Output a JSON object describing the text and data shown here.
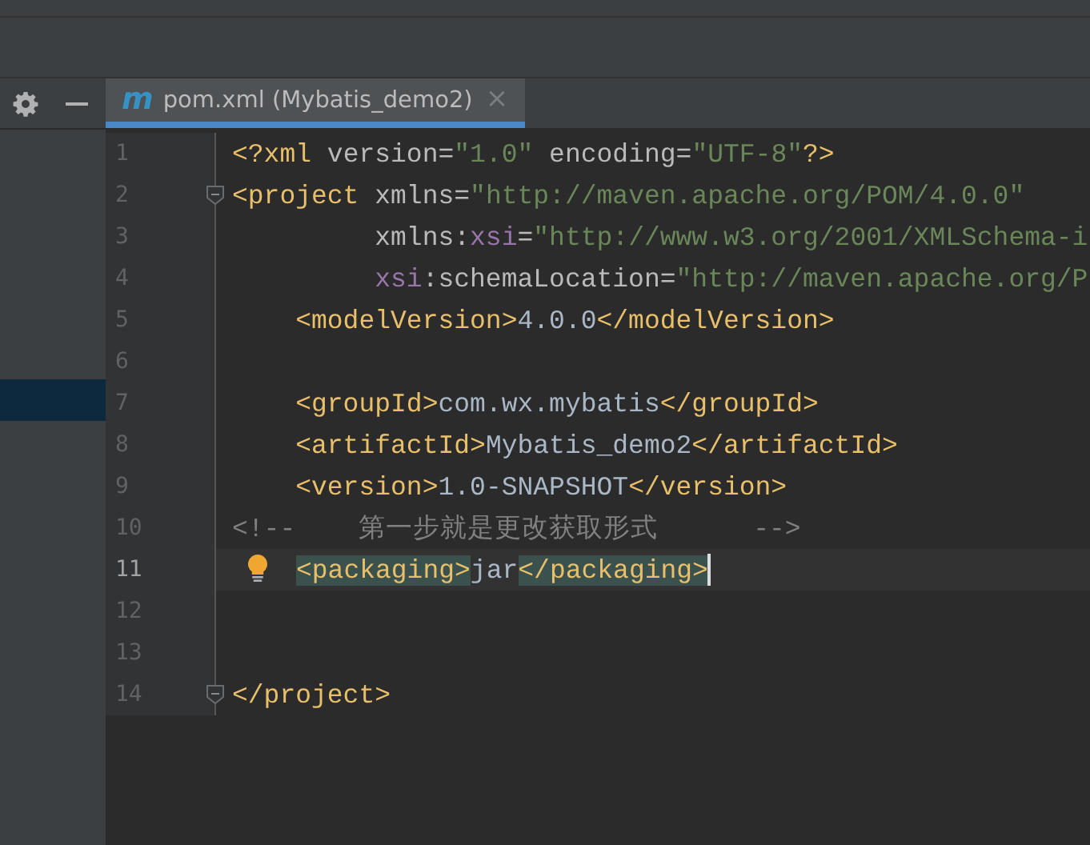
{
  "tab_bar": {
    "tab": {
      "icon_glyph": "m",
      "label": "pom.xml (Mybatis_demo2)",
      "close": "×",
      "selected": true
    }
  },
  "sidebar": {
    "items": [
      {
        "selected": false
      },
      {
        "selected": false
      },
      {
        "selected": false
      },
      {
        "selected": false
      },
      {
        "selected": false
      },
      {
        "selected": false
      },
      {
        "selected": true
      },
      {
        "selected": false
      },
      {
        "selected": false
      },
      {
        "selected": false
      },
      {
        "selected": false
      },
      {
        "selected": false
      },
      {
        "selected": false
      },
      {
        "selected": false
      },
      {
        "selected": false
      },
      {
        "selected": false
      },
      {
        "selected": false
      }
    ]
  },
  "editor": {
    "lines": [
      {
        "number": "1",
        "current": false,
        "fold": false,
        "tokens": [
          {
            "kind": "tag",
            "text": "<?xml "
          },
          {
            "kind": "attr",
            "text": "version="
          },
          {
            "kind": "value",
            "text": "\"1.0\""
          },
          {
            "kind": "attr",
            "text": " encoding="
          },
          {
            "kind": "value",
            "text": "\"UTF-8\""
          },
          {
            "kind": "tag",
            "text": "?>"
          }
        ]
      },
      {
        "number": "2",
        "current": false,
        "fold": true,
        "tokens": [
          {
            "kind": "tag",
            "text": "<project "
          },
          {
            "kind": "attr",
            "text": "xmlns="
          },
          {
            "kind": "value",
            "text": "\"http://maven.apache.org/POM/4.0.0\""
          }
        ]
      },
      {
        "number": "3",
        "current": false,
        "fold": false,
        "tokens": [
          {
            "kind": "attr",
            "text": "         xmlns:"
          },
          {
            "kind": "ns",
            "text": "xsi"
          },
          {
            "kind": "attr",
            "text": "="
          },
          {
            "kind": "value",
            "text": "\"http://www.w3.org/2001/XMLSchema-i"
          }
        ]
      },
      {
        "number": "4",
        "current": false,
        "fold": false,
        "tokens": [
          {
            "kind": "ns",
            "text": "         xsi"
          },
          {
            "kind": "attr",
            "text": ":schemaLocation="
          },
          {
            "kind": "value",
            "text": "\"http://maven.apache.org/P"
          }
        ]
      },
      {
        "number": "5",
        "current": false,
        "fold": false,
        "tokens": [
          {
            "kind": "tag",
            "text": "    <modelVersion>"
          },
          {
            "kind": "text",
            "text": "4.0.0"
          },
          {
            "kind": "tag",
            "text": "</modelVersion>"
          }
        ]
      },
      {
        "number": "6",
        "current": false,
        "fold": false
      },
      {
        "number": "7",
        "current": false,
        "fold": false,
        "tokens": [
          {
            "kind": "tag",
            "text": "    <groupId>"
          },
          {
            "kind": "text",
            "text": "com.wx.mybatis"
          },
          {
            "kind": "tag",
            "text": "</groupId>"
          }
        ]
      },
      {
        "number": "8",
        "current": false,
        "fold": false,
        "tokens": [
          {
            "kind": "tag",
            "text": "    <artifactId>"
          },
          {
            "kind": "text",
            "text": "Mybatis_demo2"
          },
          {
            "kind": "tag",
            "text": "</artifactId>"
          }
        ]
      },
      {
        "number": "9",
        "current": false,
        "fold": false,
        "tokens": [
          {
            "kind": "tag",
            "text": "    <version>"
          },
          {
            "kind": "text",
            "text": "1.0-SNAPSHOT"
          },
          {
            "kind": "tag",
            "text": "</version>"
          }
        ]
      },
      {
        "number": "10",
        "current": false,
        "fold": false,
        "tokens": [
          {
            "kind": "comment",
            "text": "<!--    第一步就是更改获取形式      -->"
          }
        ]
      },
      {
        "number": "11",
        "current": true,
        "fold": false,
        "tokens": [
          {
            "kind": "match",
            "text": "<packaging>"
          },
          {
            "kind": "text",
            "text": "jar"
          },
          {
            "kind": "match",
            "text": "</packaging>"
          }
        ]
      },
      {
        "number": "12",
        "current": false,
        "fold": false
      },
      {
        "number": "13",
        "current": false,
        "fold": false
      },
      {
        "number": "14",
        "current": false,
        "fold": true,
        "tokens": [
          {
            "kind": "tag",
            "text": "</project>"
          }
        ]
      }
    ]
  }
}
